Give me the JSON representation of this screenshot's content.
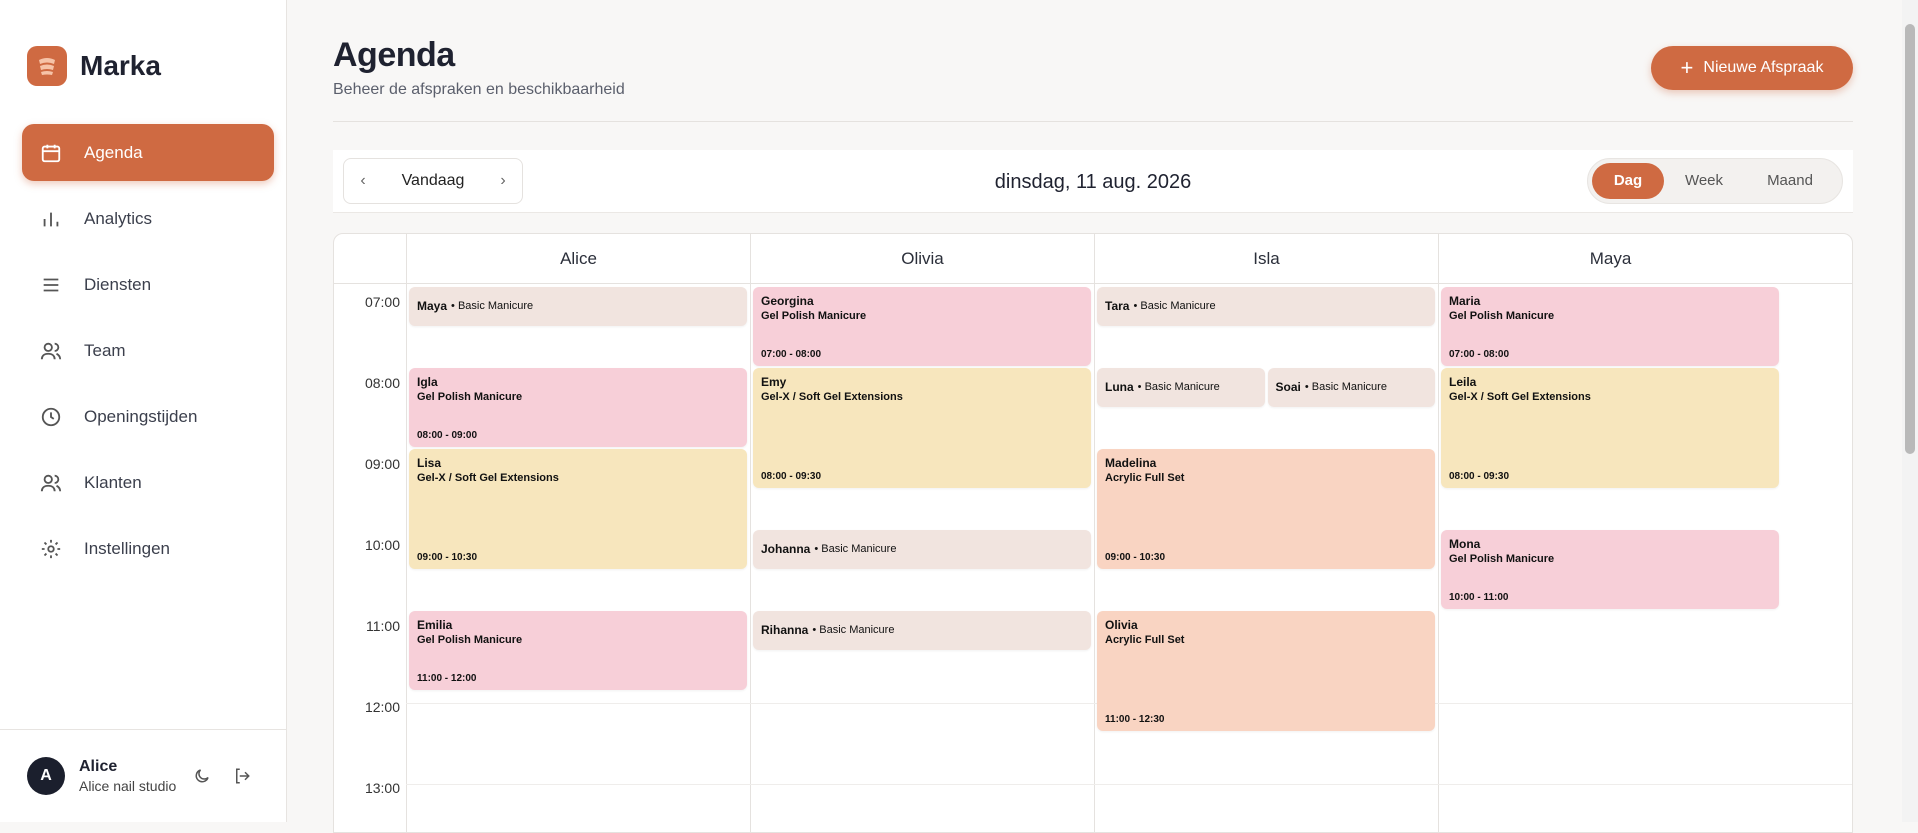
{
  "brand": {
    "name": "Marka"
  },
  "sidebar": {
    "items": [
      {
        "label": "Agenda",
        "icon": "calendar-icon",
        "active": true
      },
      {
        "label": "Analytics",
        "icon": "bar-chart-icon"
      },
      {
        "label": "Diensten",
        "icon": "list-icon"
      },
      {
        "label": "Team",
        "icon": "users-icon"
      },
      {
        "label": "Openingstijden",
        "icon": "clock-icon"
      },
      {
        "label": "Klanten",
        "icon": "users-icon"
      },
      {
        "label": "Instellingen",
        "icon": "gear-icon"
      }
    ]
  },
  "user": {
    "initial": "A",
    "name": "Alice",
    "studio": "Alice nail studio"
  },
  "header": {
    "title": "Agenda",
    "subtitle": "Beheer de afspraken en beschikbaarheid",
    "new_button": "Nieuwe Afspraak"
  },
  "toolbar": {
    "today": "Vandaag",
    "date": "dinsdag, 11 aug. 2026",
    "views": [
      "Dag",
      "Week",
      "Maand"
    ],
    "active_view": "Dag"
  },
  "calendar": {
    "staff": [
      "Alice",
      "Olivia",
      "Isla",
      "Maya"
    ],
    "hours": [
      "07:00",
      "08:00",
      "09:00",
      "10:00",
      "11:00",
      "12:00",
      "13:00"
    ],
    "colors": {
      "pink": "#f7cfd8",
      "beige": "#f1e4df",
      "yellow": "#f7e6bd",
      "peach": "#f9d4c2",
      "accent": "#cf6a42"
    }
  },
  "appointments": [
    {
      "staff": 0,
      "client": "Maya",
      "service": "• Basic Manicure",
      "start": 7.0,
      "end": 7.5,
      "color": "beige",
      "compact": true
    },
    {
      "staff": 0,
      "client": "Igla",
      "service": "Gel Polish Manicure",
      "time": "08:00 - 09:00",
      "start": 8.0,
      "end": 9.0,
      "color": "pink"
    },
    {
      "staff": 0,
      "client": "Lisa",
      "service": "Gel-X / Soft Gel Extensions",
      "time": "09:00 - 10:30",
      "start": 9.0,
      "end": 10.5,
      "color": "yellow"
    },
    {
      "staff": 0,
      "client": "Emilia",
      "service": "Gel Polish Manicure",
      "time": "11:00 - 12:00",
      "start": 11.0,
      "end": 12.0,
      "color": "pink"
    },
    {
      "staff": 1,
      "client": "Georgina",
      "service": "Gel Polish Manicure",
      "time": "07:00 - 08:00",
      "start": 7.0,
      "end": 8.0,
      "color": "pink"
    },
    {
      "staff": 1,
      "client": "Emy",
      "service": "Gel-X / Soft Gel Extensions",
      "time": "08:00 - 09:30",
      "start": 8.0,
      "end": 9.5,
      "color": "yellow"
    },
    {
      "staff": 1,
      "client": "Johanna",
      "service": "• Basic Manicure",
      "start": 10.0,
      "end": 10.5,
      "color": "beige",
      "compact": true
    },
    {
      "staff": 1,
      "client": "Rihanna",
      "service": "• Basic Manicure",
      "start": 11.0,
      "end": 11.5,
      "color": "beige",
      "compact": true
    },
    {
      "staff": 2,
      "client": "Tara",
      "service": "• Basic Manicure",
      "start": 7.0,
      "end": 7.5,
      "color": "beige",
      "compact": true
    },
    {
      "staff": 2,
      "client": "Luna",
      "service": "• Basic Manicure",
      "start": 8.0,
      "end": 8.5,
      "color": "beige",
      "compact": true,
      "half": 0
    },
    {
      "staff": 2,
      "client": "Soai",
      "service": "• Basic Manicure",
      "start": 8.0,
      "end": 8.5,
      "color": "beige",
      "compact": true,
      "half": 1
    },
    {
      "staff": 2,
      "client": "Madelina",
      "service": "Acrylic Full Set",
      "time": "09:00 - 10:30",
      "start": 9.0,
      "end": 10.5,
      "color": "peach"
    },
    {
      "staff": 2,
      "client": "Olivia",
      "service": "Acrylic Full Set",
      "time": "11:00 - 12:30",
      "start": 11.0,
      "end": 12.5,
      "color": "peach"
    },
    {
      "staff": 3,
      "client": "Maria",
      "service": "Gel Polish Manicure",
      "time": "07:00 - 08:00",
      "start": 7.0,
      "end": 8.0,
      "color": "pink"
    },
    {
      "staff": 3,
      "client": "Leila",
      "service": "Gel-X / Soft Gel Extensions",
      "time": "08:00 - 09:30",
      "start": 8.0,
      "end": 9.5,
      "color": "yellow"
    },
    {
      "staff": 3,
      "client": "Mona",
      "service": "Gel Polish Manicure",
      "time": "10:00 - 11:00",
      "start": 10.0,
      "end": 11.0,
      "color": "pink"
    }
  ]
}
